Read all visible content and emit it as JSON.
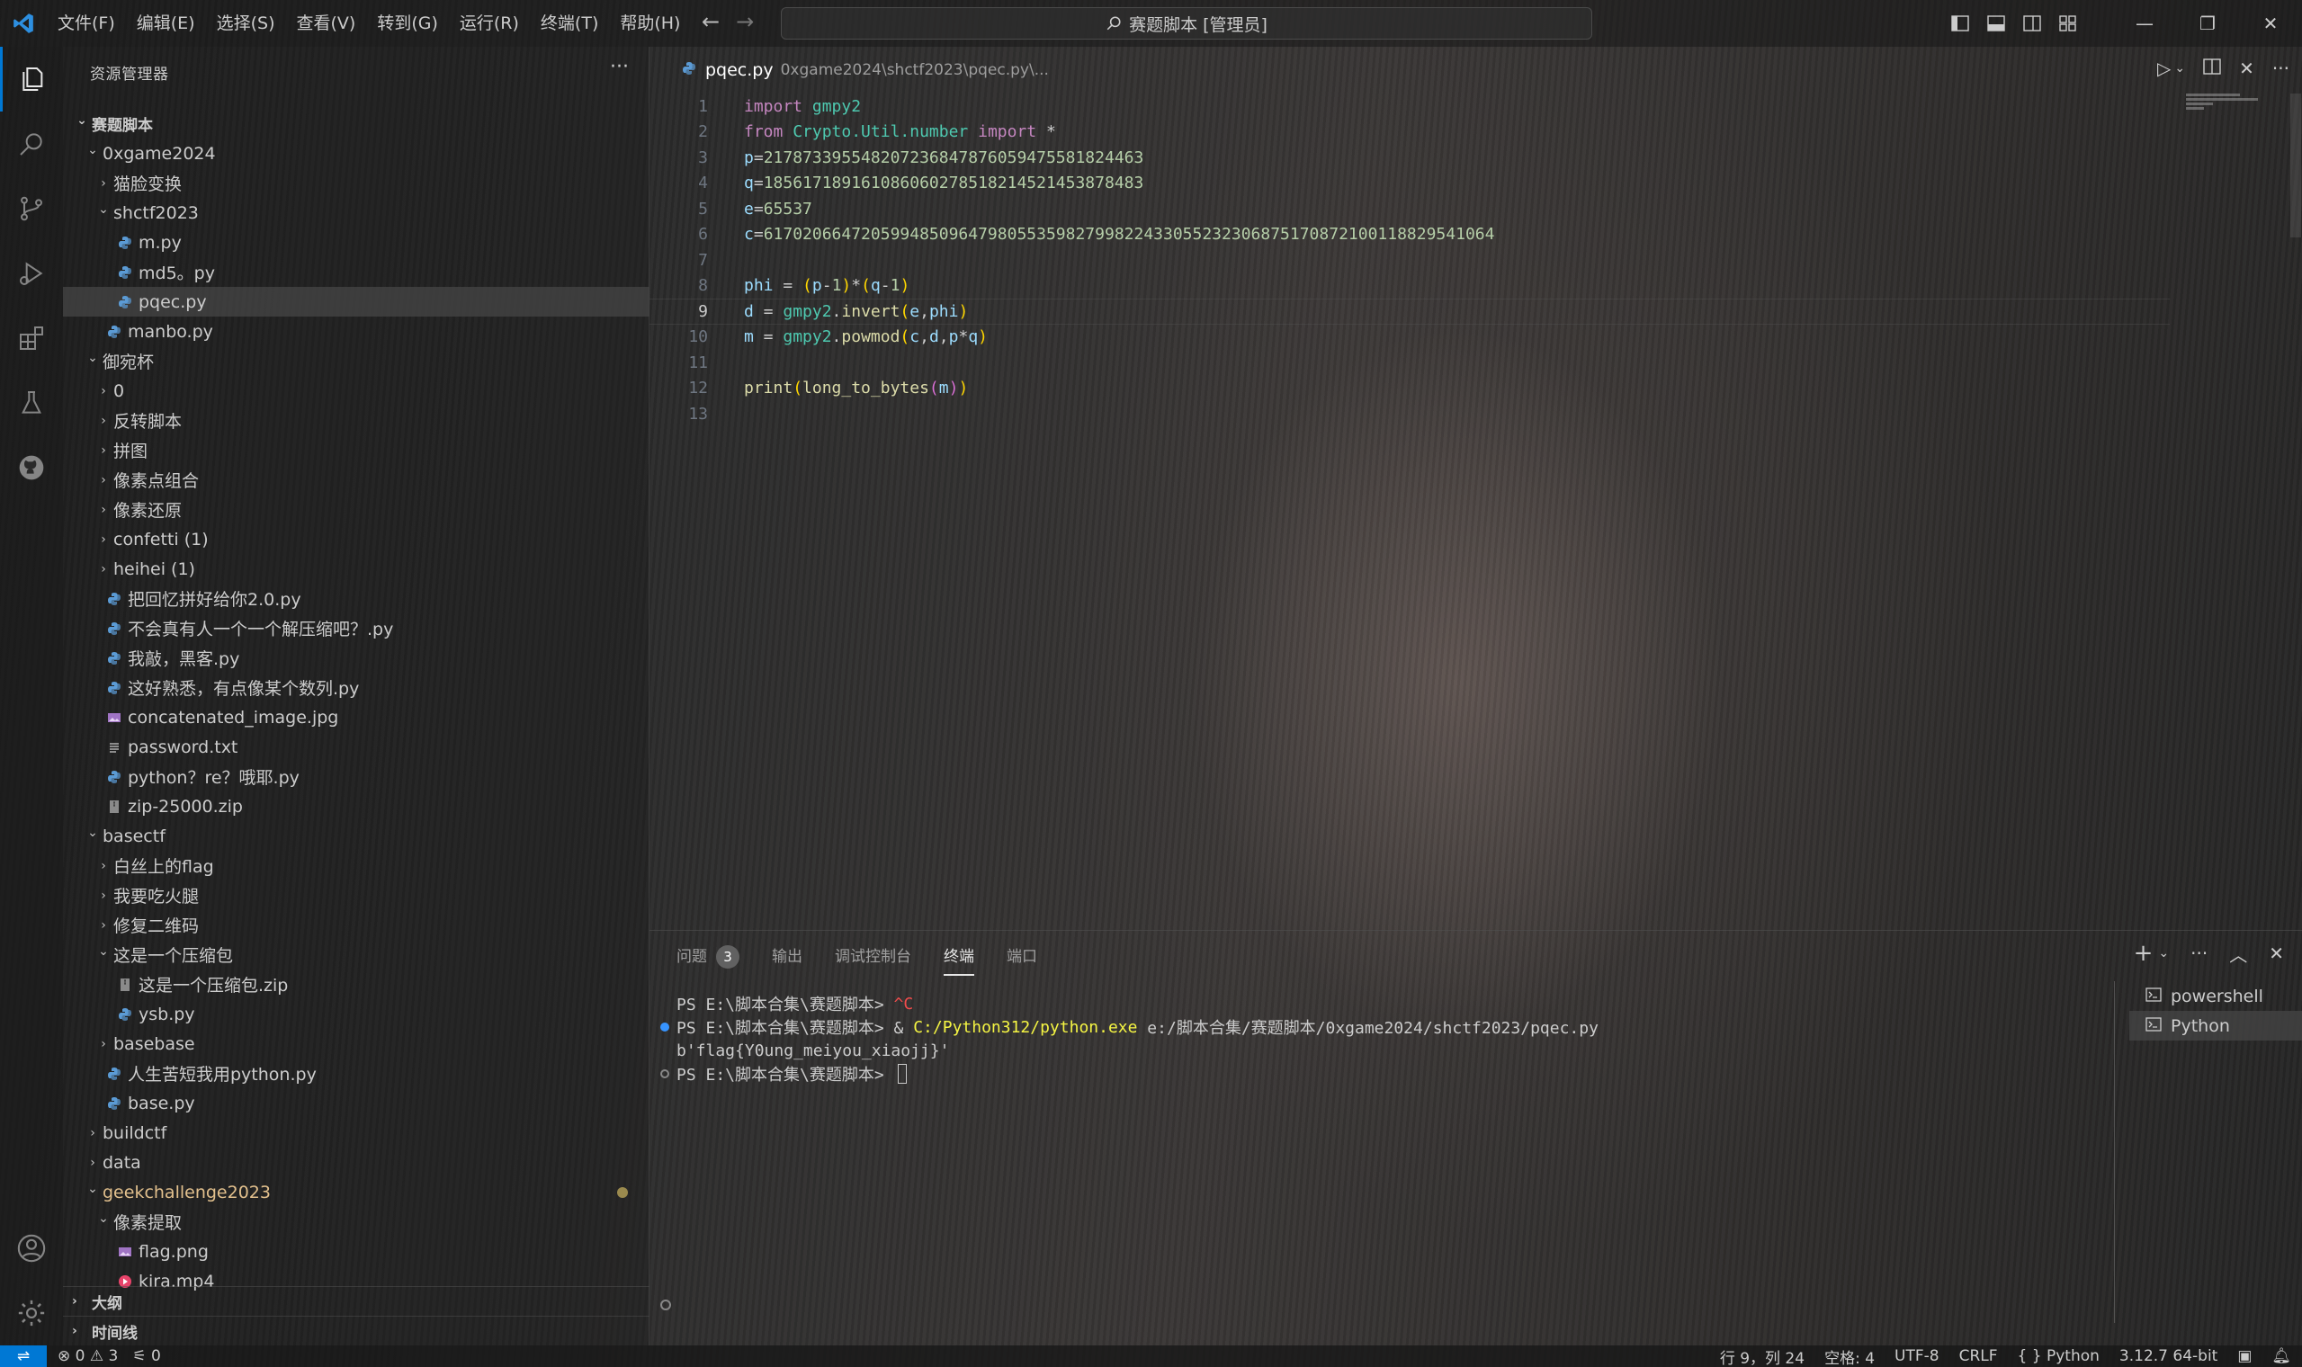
{
  "window": {
    "command_center": "赛题脚本 [管理员]"
  },
  "menu": [
    "文件(F)",
    "编辑(E)",
    "选择(S)",
    "查看(V)",
    "转到(G)",
    "运行(R)",
    "终端(T)",
    "帮助(H)"
  ],
  "sidebar": {
    "header": "资源管理器",
    "more": "···",
    "tree": [
      {
        "label": "赛题脚本",
        "depth": 0,
        "kind": "root",
        "open": true
      },
      {
        "label": "0xgame2024",
        "depth": 1,
        "kind": "folder",
        "open": true
      },
      {
        "label": "猫脸变换",
        "depth": 2,
        "kind": "folder",
        "open": false
      },
      {
        "label": "shctf2023",
        "depth": 2,
        "kind": "folder",
        "open": true
      },
      {
        "label": "m.py",
        "depth": 3,
        "kind": "py"
      },
      {
        "label": "md5。py",
        "depth": 3,
        "kind": "py"
      },
      {
        "label": "pqec.py",
        "depth": 3,
        "kind": "py",
        "selected": true
      },
      {
        "label": "manbo.py",
        "depth": 2,
        "kind": "py"
      },
      {
        "label": "御宛杯",
        "depth": 1,
        "kind": "folder",
        "open": true
      },
      {
        "label": "0",
        "depth": 2,
        "kind": "folder",
        "open": false
      },
      {
        "label": "反转脚本",
        "depth": 2,
        "kind": "folder",
        "open": false
      },
      {
        "label": "拼图",
        "depth": 2,
        "kind": "folder",
        "open": false
      },
      {
        "label": "像素点组合",
        "depth": 2,
        "kind": "folder",
        "open": false
      },
      {
        "label": "像素还原",
        "depth": 2,
        "kind": "folder",
        "open": false
      },
      {
        "label": "confetti (1)",
        "depth": 2,
        "kind": "folder",
        "open": false
      },
      {
        "label": "heihei (1)",
        "depth": 2,
        "kind": "folder",
        "open": false
      },
      {
        "label": "把回忆拼好给你2.0.py",
        "depth": 2,
        "kind": "py"
      },
      {
        "label": "不会真有人一个一个解压缩吧？.py",
        "depth": 2,
        "kind": "py"
      },
      {
        "label": "我敲，黑客.py",
        "depth": 2,
        "kind": "py"
      },
      {
        "label": "这好熟悉，有点像某个数列.py",
        "depth": 2,
        "kind": "py"
      },
      {
        "label": "concatenated_image.jpg",
        "depth": 2,
        "kind": "img"
      },
      {
        "label": "password.txt",
        "depth": 2,
        "kind": "txt"
      },
      {
        "label": "python？re？哦耶.py",
        "depth": 2,
        "kind": "py"
      },
      {
        "label": "zip-25000.zip",
        "depth": 2,
        "kind": "zip"
      },
      {
        "label": "basectf",
        "depth": 1,
        "kind": "folder",
        "open": true
      },
      {
        "label": "白丝上的flag",
        "depth": 2,
        "kind": "folder",
        "open": false
      },
      {
        "label": "我要吃火腿",
        "depth": 2,
        "kind": "folder",
        "open": false
      },
      {
        "label": "修复二维码",
        "depth": 2,
        "kind": "folder",
        "open": false
      },
      {
        "label": "这是一个压缩包",
        "depth": 2,
        "kind": "folder",
        "open": true
      },
      {
        "label": "这是一个压缩包.zip",
        "depth": 3,
        "kind": "zip"
      },
      {
        "label": "ysb.py",
        "depth": 3,
        "kind": "py"
      },
      {
        "label": "basebase",
        "depth": 2,
        "kind": "folder",
        "open": false
      },
      {
        "label": "人生苦短我用python.py",
        "depth": 2,
        "kind": "py"
      },
      {
        "label": "base.py",
        "depth": 2,
        "kind": "py"
      },
      {
        "label": "buildctf",
        "depth": 1,
        "kind": "folder",
        "open": false
      },
      {
        "label": "data",
        "depth": 1,
        "kind": "folder",
        "open": false
      },
      {
        "label": "geekchallenge2023",
        "depth": 1,
        "kind": "folder",
        "open": true,
        "modified": true
      },
      {
        "label": "像素提取",
        "depth": 2,
        "kind": "folder",
        "open": true
      },
      {
        "label": "flag.png",
        "depth": 3,
        "kind": "img"
      },
      {
        "label": "kira.mp4",
        "depth": 3,
        "kind": "video"
      }
    ],
    "outline": "大纲",
    "timeline": "时间线"
  },
  "editor": {
    "tab_name": "pqec.py",
    "tab_path": "0xgame2024\\shctf2023\\pqec.py\\...",
    "current_line": 9,
    "lines": [
      [
        [
          "kw",
          "import"
        ],
        [
          "t",
          " "
        ],
        [
          "mod-c",
          "gmpy2"
        ]
      ],
      [
        [
          "kw",
          "from"
        ],
        [
          "t",
          " "
        ],
        [
          "mod-c",
          "Crypto.Util.number"
        ],
        [
          "t",
          " "
        ],
        [
          "kw",
          "import"
        ],
        [
          "t",
          " *"
        ]
      ],
      [
        [
          "var",
          "p"
        ],
        [
          "t",
          "="
        ],
        [
          "num",
          "217873395548207236847876059475581824463"
        ]
      ],
      [
        [
          "var",
          "q"
        ],
        [
          "t",
          "="
        ],
        [
          "num",
          "185617189161086060278518214521453878483"
        ]
      ],
      [
        [
          "var",
          "e"
        ],
        [
          "t",
          "="
        ],
        [
          "num",
          "65537"
        ]
      ],
      [
        [
          "var",
          "c"
        ],
        [
          "t",
          "="
        ],
        [
          "num",
          "617020664720599485096479805535982799822433055232306875170872100118829541064"
        ]
      ],
      [],
      [
        [
          "var",
          "phi"
        ],
        [
          "t",
          " = "
        ],
        [
          "br1",
          "("
        ],
        [
          "var",
          "p"
        ],
        [
          "t",
          "-"
        ],
        [
          "num",
          "1"
        ],
        [
          "br1",
          ")"
        ],
        [
          "t",
          "*"
        ],
        [
          "br1",
          "("
        ],
        [
          "var",
          "q"
        ],
        [
          "t",
          "-"
        ],
        [
          "num",
          "1"
        ],
        [
          "br1",
          ")"
        ]
      ],
      [
        [
          "var",
          "d"
        ],
        [
          "t",
          " = "
        ],
        [
          "mod-c",
          "gmpy2"
        ],
        [
          "t",
          "."
        ],
        [
          "fn",
          "invert"
        ],
        [
          "br1",
          "("
        ],
        [
          "var",
          "e"
        ],
        [
          "t",
          ","
        ],
        [
          "var",
          "phi"
        ],
        [
          "br1",
          ")"
        ]
      ],
      [
        [
          "var",
          "m"
        ],
        [
          "t",
          " = "
        ],
        [
          "mod-c",
          "gmpy2"
        ],
        [
          "t",
          "."
        ],
        [
          "fn",
          "powmod"
        ],
        [
          "br1",
          "("
        ],
        [
          "var",
          "c"
        ],
        [
          "t",
          ","
        ],
        [
          "var",
          "d"
        ],
        [
          "t",
          ","
        ],
        [
          "var",
          "p"
        ],
        [
          "t",
          "*"
        ],
        [
          "var",
          "q"
        ],
        [
          "br1",
          ")"
        ]
      ],
      [],
      [
        [
          "fn",
          "print"
        ],
        [
          "br1",
          "("
        ],
        [
          "fn",
          "long_to_bytes"
        ],
        [
          "br2",
          "("
        ],
        [
          "var",
          "m"
        ],
        [
          "br2",
          ")"
        ],
        [
          "br1",
          ")"
        ]
      ],
      []
    ]
  },
  "panel": {
    "tabs": [
      "问题",
      "输出",
      "调试控制台",
      "终端",
      "端口"
    ],
    "active_tab": "终端",
    "problems_count": "3",
    "terminal": [
      {
        "dot": "none",
        "parts": [
          [
            "t",
            "PS E:\\脚本合集\\赛题脚本> "
          ],
          [
            "t-ctrl",
            "^C"
          ]
        ]
      },
      {
        "dot": "blue",
        "parts": [
          [
            "t",
            "PS E:\\脚本合集\\赛题脚本> & "
          ],
          [
            "t-exe",
            "C:/Python312/python.exe"
          ],
          [
            "t",
            " e:/脚本合集/赛题脚本/0xgame2024/shctf2023/pqec.py"
          ]
        ]
      },
      {
        "dot": "none",
        "parts": [
          [
            "t",
            "b'flag{Y0ung_meiyou_xiaojj}'"
          ]
        ]
      },
      {
        "dot": "ring",
        "parts": [
          [
            "t",
            "PS E:\\脚本合集\\赛题脚本> "
          ]
        ],
        "cursor": true
      }
    ],
    "terminal_list": [
      "powershell",
      "Python"
    ]
  },
  "statusbar": {
    "errors": "0",
    "warnings": "3",
    "ports": "0",
    "position": "行 9，列 24",
    "spaces": "空格: 4",
    "encoding": "UTF-8",
    "eol": "CRLF",
    "language": "Python",
    "interpreter": "3.12.7 64-bit"
  },
  "colors": {
    "accent": "#0078d4",
    "keyword": "#c586c0",
    "module": "#4ec9b0",
    "function": "#dcdcaa",
    "variable": "#9cdcfe",
    "number": "#b5cea8",
    "modified": "#e2c08d"
  }
}
